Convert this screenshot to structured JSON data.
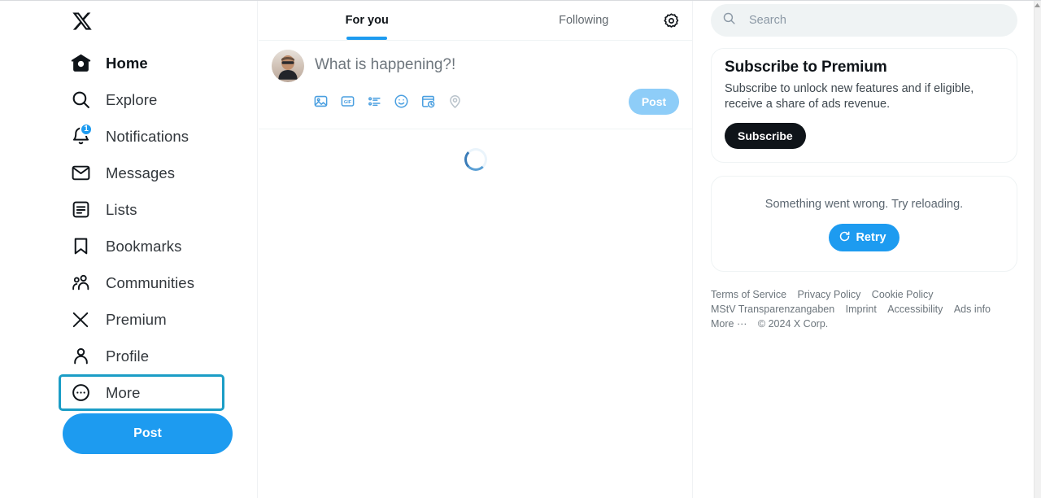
{
  "brand": {
    "logo_icon": "x-logo-icon",
    "accent_blue": "#1d9bf0",
    "focus_teal": "#1b9dc6",
    "text_primary": "#0f1419",
    "text_secondary": "#6c757c",
    "surface": "#ffffff",
    "search_bg": "#eff3f4"
  },
  "sidebar": {
    "items": [
      {
        "label": "Home",
        "icon": "home-icon",
        "active": true,
        "focused": false,
        "badge": null
      },
      {
        "label": "Explore",
        "icon": "search-icon",
        "active": false,
        "focused": false,
        "badge": null
      },
      {
        "label": "Notifications",
        "icon": "bell-icon",
        "active": false,
        "focused": false,
        "badge": "1"
      },
      {
        "label": "Messages",
        "icon": "envelope-icon",
        "active": false,
        "focused": false,
        "badge": null
      },
      {
        "label": "Lists",
        "icon": "list-icon",
        "active": false,
        "focused": false,
        "badge": null
      },
      {
        "label": "Bookmarks",
        "icon": "bookmark-icon",
        "active": false,
        "focused": false,
        "badge": null
      },
      {
        "label": "Communities",
        "icon": "communities-icon",
        "active": false,
        "focused": false,
        "badge": null
      },
      {
        "label": "Premium",
        "icon": "x-logo-icon",
        "active": false,
        "focused": false,
        "badge": null
      },
      {
        "label": "Profile",
        "icon": "person-icon",
        "active": false,
        "focused": false,
        "badge": null
      },
      {
        "label": "More",
        "icon": "more-circle-icon",
        "active": false,
        "focused": true,
        "badge": null
      }
    ],
    "post_button": "Post"
  },
  "center": {
    "tabs": [
      {
        "label": "For you",
        "active": true
      },
      {
        "label": "Following",
        "active": false
      }
    ],
    "settings_icon": "gear-icon",
    "composer": {
      "avatar": "user-avatar",
      "placeholder": "What is happening?!",
      "post_button": "Post",
      "tools": [
        {
          "name": "media-icon",
          "enabled": true
        },
        {
          "name": "gif-icon",
          "enabled": true
        },
        {
          "name": "poll-icon",
          "enabled": true
        },
        {
          "name": "emoji-icon",
          "enabled": true
        },
        {
          "name": "schedule-icon",
          "enabled": true
        },
        {
          "name": "location-icon",
          "enabled": false
        }
      ]
    },
    "feed_status": "loading"
  },
  "right": {
    "search": {
      "placeholder": "Search",
      "value": "",
      "icon": "search-icon"
    },
    "premium_card": {
      "title": "Subscribe to Premium",
      "description": "Subscribe to unlock new features and if eligible, receive a share of ads revenue.",
      "button": "Subscribe"
    },
    "error_card": {
      "message": "Something went wrong. Try reloading.",
      "retry_button": "Retry",
      "retry_icon": "refresh-icon"
    },
    "footer": [
      "Terms of Service",
      "Privacy Policy",
      "Cookie Policy",
      "MStV Transparenzangaben",
      "Imprint",
      "Accessibility",
      "Ads info",
      "More ···",
      "© 2024 X Corp."
    ]
  }
}
